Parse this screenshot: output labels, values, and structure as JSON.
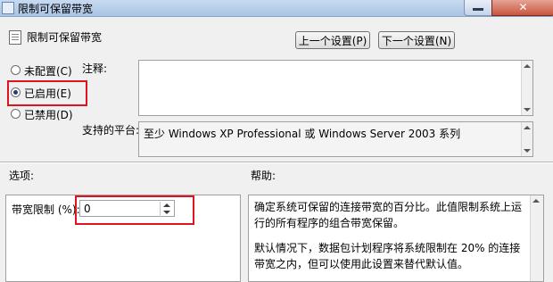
{
  "window": {
    "title": "限制可保留带宽"
  },
  "header": {
    "title": "限制可保留带宽"
  },
  "nav": {
    "prev_label": "上一个设置(P)",
    "next_label": "下一个设置(N)"
  },
  "state": {
    "not_configured": "未配置(C)",
    "enabled": "已启用(E)",
    "disabled": "已禁用(D)",
    "selected": "enabled"
  },
  "comment": {
    "label": "注释:",
    "value": ""
  },
  "supported": {
    "label": "支持的平台:",
    "value": "至少 Windows XP Professional 或 Windows Server 2003 系列"
  },
  "options": {
    "section_label": "选项:",
    "bandwidth_label": "带宽限制 (%):",
    "bandwidth_value": "0"
  },
  "help": {
    "section_label": "帮助:",
    "para1": "确定系统可保留的连接带宽的百分比。此值限制系统上运行的所有程序的组合带宽保留。",
    "para2": "默认情况下，数据包计划程序将系统限制在 20% 的连接带宽之内，但可以使用此设置来替代默认值。"
  },
  "colors": {
    "highlight": "#e0141e",
    "titlebar": "#b8cfe9",
    "close": "#c8553e"
  }
}
